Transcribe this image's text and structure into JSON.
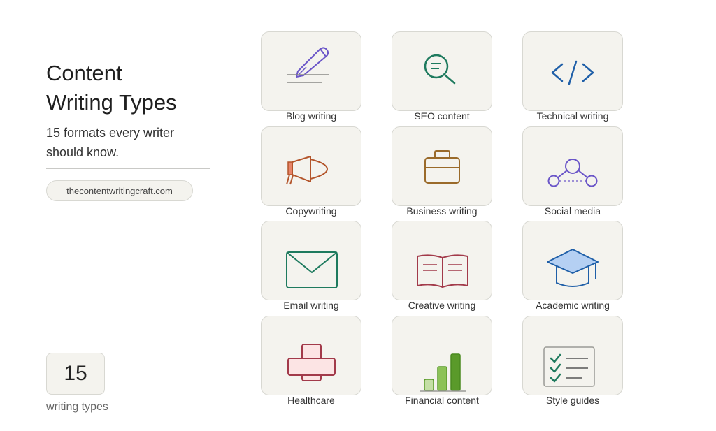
{
  "header": {
    "title_line1": "Content",
    "title_line2": "Writing Types",
    "subtitle_line1": "15 formats every writer",
    "subtitle_line2": "should know."
  },
  "site": {
    "url": "thecontentwritingcraft.com"
  },
  "summary": {
    "count": "15",
    "count_label": "writing types"
  },
  "colors": {
    "tile_bg": "#f4f3ee",
    "tile_border": "#d8d8d2",
    "purple": "#6a55c8",
    "teal": "#1e7a5e",
    "blue": "#1f5fa8",
    "orange_brown": "#b3542a",
    "amber": "#9a6a2a",
    "crimson": "#a23a4a",
    "green": "#5a9a2a"
  },
  "tiles": [
    {
      "label": "Blog writing",
      "icon": "pen-lines-icon"
    },
    {
      "label": "SEO content",
      "icon": "magnifier-icon"
    },
    {
      "label": "Technical writing",
      "icon": "code-brackets-icon"
    },
    {
      "label": "Copywriting",
      "icon": "megaphone-icon"
    },
    {
      "label": "Business writing",
      "icon": "briefcase-icon"
    },
    {
      "label": "Social media",
      "icon": "network-nodes-icon"
    },
    {
      "label": "Email writing",
      "icon": "envelope-icon"
    },
    {
      "label": "Creative writing",
      "icon": "open-book-icon"
    },
    {
      "label": "Academic writing",
      "icon": "graduation-cap-icon"
    },
    {
      "label": "Healthcare",
      "icon": "medical-kit-icon"
    },
    {
      "label": "Financial content",
      "icon": "bar-chart-icon"
    },
    {
      "label": "Style guides",
      "icon": "checklist-icon"
    }
  ]
}
